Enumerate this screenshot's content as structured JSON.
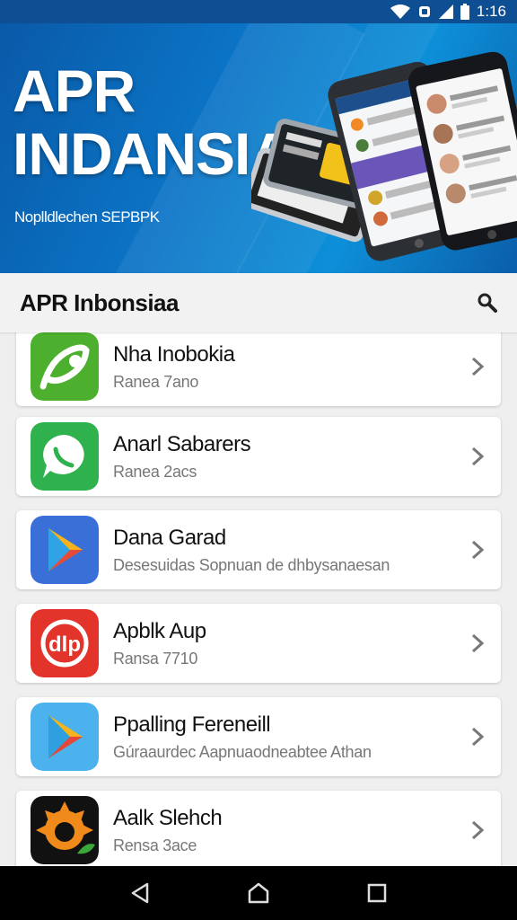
{
  "status_bar": {
    "time": "1:16"
  },
  "banner": {
    "title": "APR\nINDANSIA",
    "subtitle": "Noplldlechen SEPBPK"
  },
  "header": {
    "title": "APR Inbonsiaa"
  },
  "apps": [
    {
      "name": "Nha Inobokia",
      "sub": "Ranea 7ano",
      "icon": "green-leaf-icon"
    },
    {
      "name": "Anarl Sabarers",
      "sub": "Ranea 2acs",
      "icon": "green-chat-bubble-icon"
    },
    {
      "name": "Dana Garad",
      "sub": "Desesuidas Sopnuan de dhbysanaesan",
      "icon": "play-triangle-blue-icon"
    },
    {
      "name": "Apblk Aup",
      "sub": "Ransa 7710",
      "icon": "red-circle-dlp-icon"
    },
    {
      "name": "Ppalling Fereneill",
      "sub": "Gúraaurdec Aapnuaodneabtee Athan",
      "icon": "play-triangle-lightblue-icon"
    },
    {
      "name": "Aalk Slehch",
      "sub": "Rensa 3ace",
      "icon": "sun-orange-icon"
    }
  ],
  "colors": {
    "banner": "#0b74c6",
    "status_bar": "#0e4f93",
    "nav_bar": "#000000"
  }
}
